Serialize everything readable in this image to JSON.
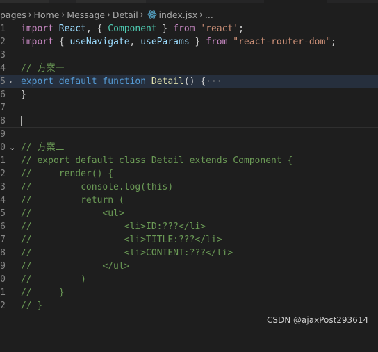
{
  "breadcrumb": {
    "items": [
      "pages",
      "Home",
      "Message",
      "Detail"
    ],
    "file": "index.jsx",
    "trail": "..."
  },
  "gutter": {
    "line_numbers": [
      "1",
      "2",
      "3",
      "4",
      "5",
      "6",
      "7",
      "8",
      "9",
      "0",
      "1",
      "2",
      "3",
      "4",
      "5",
      "6",
      "7",
      "8",
      "9",
      "0",
      "1",
      "2"
    ]
  },
  "code": {
    "l1": {
      "t1": "import",
      "t2": "React",
      "t3": ", {",
      "t4": "Component",
      "t5": "}",
      "t6": "from",
      "t7": "'react'",
      "t8": ";"
    },
    "l2": {
      "t1": "import",
      "t2": "{",
      "t3": "useNavigate",
      "t4": ",",
      "t5": "useParams",
      "t6": "}",
      "t7": "from",
      "t8": "\"react-router-dom\"",
      "t9": ";"
    },
    "l4": "// 方案一",
    "l5": {
      "t1": "export",
      "t2": "default",
      "t3": "function",
      "t4": "Detail",
      "t5": "() {",
      "t6": "···"
    },
    "l6": "}",
    "l9": "// 方案二",
    "l10": "// export default class Detail extends Component {",
    "l11": "//     render() {",
    "l12": "//         console.log(this)",
    "l13": "//         return (",
    "l14": "//             <ul>",
    "l15": "//                 <li>ID:???</li>",
    "l16": "//                 <li>TITLE:???</li>",
    "l17": "//                 <li>CONTENT:???</li>",
    "l18": "//             </ul>",
    "l19": "//         )",
    "l20": "//     }",
    "l21": "// }"
  },
  "watermark": "CSDN @ajaxPost293614",
  "colors": {
    "background": "#1e1e1e",
    "keyword": "#569cd6",
    "control_keyword": "#c586c0",
    "function": "#dcdcaa",
    "variable": "#9cdcfe",
    "class": "#4ec9b0",
    "string": "#ce9178",
    "comment": "#6a9955"
  }
}
